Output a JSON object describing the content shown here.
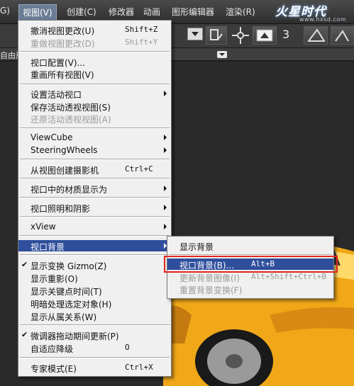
{
  "menubar": {
    "left_fragment": "G)",
    "items": [
      "视图(V)",
      "创建(C)",
      "修改器",
      "动画",
      "图形编辑器",
      "渲染(R)"
    ],
    "watermark": "火星时代",
    "watermark_url": "www.hxsd.com"
  },
  "toolbar": {
    "number_3": "3",
    "subbar_label": "自由形"
  },
  "view_menu": {
    "items": [
      {
        "label": "撤消视图更改(U)",
        "shortcut": "Shift+Z"
      },
      {
        "label": "重做视图更改(D)",
        "shortcut": "Shift+Y"
      },
      {
        "label": "视口配置(V)..."
      },
      {
        "label": "重画所有视图(V)"
      },
      {
        "label": "设置活动视口"
      },
      {
        "label": "保存活动透视视图(S)"
      },
      {
        "label": "还原活动透视视图(A)"
      },
      {
        "label": "ViewCube"
      },
      {
        "label": "SteeringWheels"
      },
      {
        "label": "从视图创建摄影机",
        "shortcut": "Ctrl+C"
      },
      {
        "label": "视口中的材质显示为"
      },
      {
        "label": "视口照明和阴影"
      },
      {
        "label": "xView"
      },
      {
        "label": "视口背景"
      },
      {
        "label": "显示变换 Gizmo(Z)"
      },
      {
        "label": "显示重影(O)"
      },
      {
        "label": "显示关键点时间(T)"
      },
      {
        "label": "明暗处理选定对象(H)"
      },
      {
        "label": "显示从属关系(W)"
      },
      {
        "label": "微调器拖动期间更新(P)"
      },
      {
        "label": "自适应降级",
        "shortcut": "O"
      },
      {
        "label": "专家模式(E)",
        "shortcut": "Ctrl+X"
      }
    ]
  },
  "bg_submenu": {
    "items": [
      {
        "label": "显示背景"
      },
      {
        "label": "视口背景(B)...",
        "shortcut": "Alt+B"
      },
      {
        "label": "更新背景图像(I)",
        "shortcut": "Alt+Shift+Ctrl+B"
      },
      {
        "label": "重置背景变换(F)"
      }
    ]
  },
  "colors": {
    "highlight": "#2f4e9c",
    "red_box": "#e0261f",
    "car": "#f0a818"
  }
}
